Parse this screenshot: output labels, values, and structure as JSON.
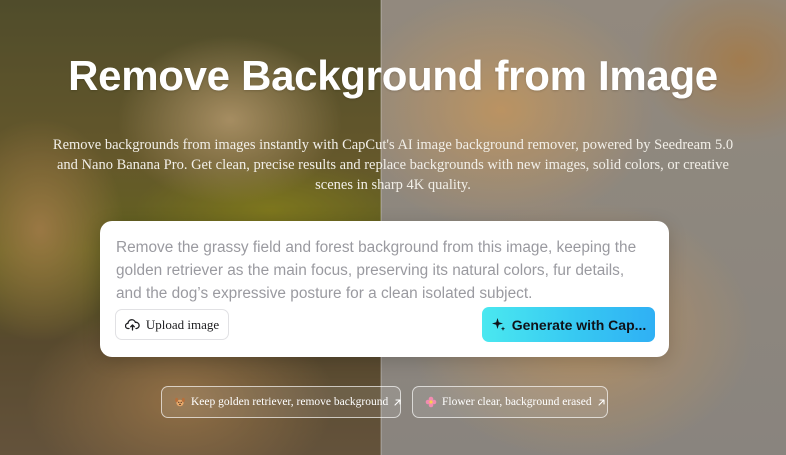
{
  "hero": {
    "title": "Remove Background from Image",
    "description": "Remove backgrounds from images instantly with CapCut's AI image background remover, powered by Seedream 5.0 and Nano Banana Pro. Get clean, precise results and replace backgrounds with new images, solid colors, or creative scenes in sharp 4K quality."
  },
  "prompt_card": {
    "prompt_text": "Remove the grassy field and forest background from this image, keeping the golden retriever as the main focus, preserving its natural colors, fur details, and the dog’s expressive posture for a clean isolated subject.",
    "upload_label": "Upload image",
    "upload_icon": "cloud-upload-icon",
    "generate_label": "Generate with Cap...",
    "generate_icon": "sparkle-icon",
    "generate_gradient": [
      "#4ae8f0",
      "#2fb0f4"
    ]
  },
  "suggestions": [
    {
      "icon": "dog-icon",
      "label": "Keep golden retriever, remove background"
    },
    {
      "icon": "flower-icon",
      "label": "Flower clear, background erased"
    }
  ]
}
